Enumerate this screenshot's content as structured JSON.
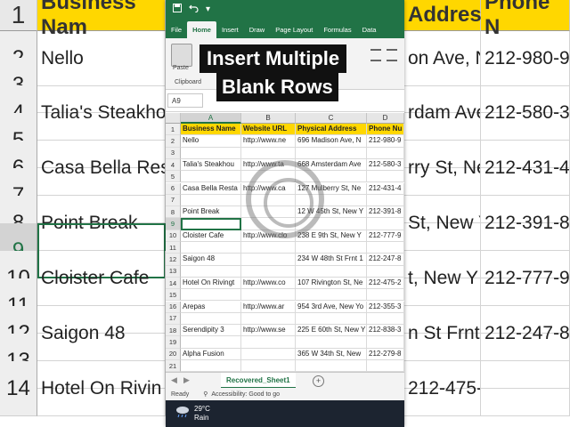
{
  "background": {
    "col_headers": [
      "1",
      "Business Nam",
      "Address",
      "Phone N"
    ],
    "rows": [
      {
        "num": "2",
        "a": "Nello",
        "b": "on Ave, N",
        "c": "212-980-9"
      },
      {
        "num": "3",
        "a": "",
        "b": "",
        "c": ""
      },
      {
        "num": "4",
        "a": "Talia's Steakho",
        "b": "rdam Ave",
        "c": "212-580-3"
      },
      {
        "num": "5",
        "a": "",
        "b": "",
        "c": ""
      },
      {
        "num": "6",
        "a": "Casa Bella Res",
        "b": "rry St, Ne",
        "c": "212-431-4"
      },
      {
        "num": "7",
        "a": "",
        "b": "",
        "c": ""
      },
      {
        "num": "8",
        "a": "Point Break",
        "b": "St, New Y",
        "c": "212-391-8"
      },
      {
        "num": "9",
        "a": "",
        "b": "",
        "c": ""
      },
      {
        "num": "10",
        "a": "Cloister Cafe",
        "b": "t, New Y",
        "c": "212-777-9"
      },
      {
        "num": "11",
        "a": "",
        "b": "",
        "c": ""
      },
      {
        "num": "12",
        "a": "Saigon 48",
        "b": "n St Frnt 1",
        "c": "212-247-8"
      },
      {
        "num": "13",
        "a": "",
        "b": "",
        "c": ""
      },
      {
        "num": "14",
        "a": "Hotel On Rivin",
        "b": "212-475-2",
        "c": ""
      }
    ]
  },
  "quick_access": {
    "save_icon": "save-icon",
    "undo_icon": "undo-icon",
    "customize": "▾"
  },
  "ribbon": {
    "tabs": [
      "File",
      "Home",
      "Insert",
      "Draw",
      "Page Layout",
      "Formulas",
      "Data"
    ],
    "active_tab": "Home",
    "paste_label": "Paste",
    "clipboard_label": "Clipboard"
  },
  "formula_bar": {
    "name_box": "A9"
  },
  "grid": {
    "columns": [
      "A",
      "B",
      "C",
      "D"
    ],
    "row_numbers": [
      "1",
      "2",
      "3",
      "4",
      "5",
      "6",
      "7",
      "8",
      "9",
      "10",
      "11",
      "12",
      "13",
      "14",
      "15",
      "16",
      "17",
      "18",
      "19",
      "20",
      "21"
    ],
    "header": [
      "Business Name",
      "Website URL",
      "Physical Address",
      "Phone Nu"
    ],
    "rows": [
      [
        "Nello",
        "http://www.ne",
        "696 Madison Ave, N",
        "212-980-9"
      ],
      [
        "",
        "",
        "",
        ""
      ],
      [
        "Talia's Steakhou",
        "http://www.ta",
        "668 Amsterdam Ave",
        "212-580-3"
      ],
      [
        "",
        "",
        "",
        ""
      ],
      [
        "Casa Bella Resta",
        "http://www.ca",
        "127 Mulberry St, Ne",
        "212-431-4"
      ],
      [
        "",
        "",
        "",
        ""
      ],
      [
        "Point Break",
        "",
        "12 W 45th St, New Y",
        "212-391-8"
      ],
      [
        "",
        "",
        "",
        ""
      ],
      [
        "Cloister Cafe",
        "http://www.clo",
        "238 E 9th St, New Y",
        "212-777-9"
      ],
      [
        "",
        "",
        "",
        ""
      ],
      [
        "Saigon 48",
        "",
        "234 W 48th St Frnt 1",
        "212-247-8"
      ],
      [
        "",
        "",
        "",
        ""
      ],
      [
        "Hotel On Rivingt",
        "http://www.co",
        "107 Rivington St, Ne",
        "212-475-2"
      ],
      [
        "",
        "",
        "",
        ""
      ],
      [
        "Arepas",
        "http://www.ar",
        "954 3rd Ave, New Yo",
        "212-355-3"
      ],
      [
        "",
        "",
        "",
        ""
      ],
      [
        "Serendipity 3",
        "http://www.se",
        "225 E 60th St, New Y",
        "212-838-3"
      ],
      [
        "",
        "",
        "",
        ""
      ],
      [
        "Alpha Fusion",
        "",
        "365 W 34th St, New",
        "212-279-8"
      ],
      [
        "",
        "",
        "",
        ""
      ]
    ]
  },
  "sheet_tab": "Recovered_Sheet1",
  "status": {
    "ready": "Ready",
    "accessibility": "Accessibility: Good to go"
  },
  "taskbar": {
    "temperature": "29°C",
    "condition": "Rain"
  },
  "overlay": {
    "line1": "Insert Multiple",
    "line2": "Blank Rows"
  },
  "colors": {
    "excel_green": "#217346",
    "header_yellow": "#ffd700"
  }
}
